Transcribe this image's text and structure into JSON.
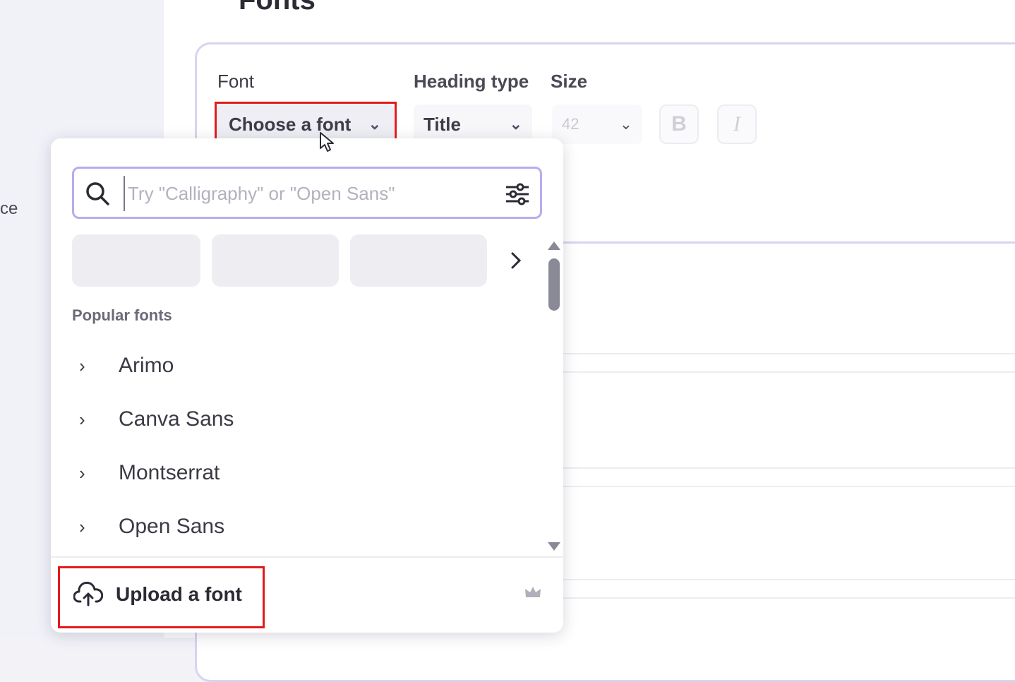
{
  "left_panel": {
    "partial_text": "ce"
  },
  "page": {
    "title": "Fonts"
  },
  "editor": {
    "font_label": "Font",
    "heading_type_label": "Heading type",
    "size_label": "Size",
    "font_select_value": "Choose a font",
    "heading_type_value": "Title",
    "size_value": "42",
    "bold_label": "B",
    "italic_label": "I"
  },
  "font_picker": {
    "search_placeholder": "Try \"Calligraphy\" or \"Open Sans\"",
    "popular_label": "Popular fonts",
    "popular_fonts": [
      "Arimo",
      "Canva Sans",
      "Montserrat",
      "Open Sans"
    ],
    "upload_label": "Upload a font"
  },
  "icons": [
    "search-icon",
    "filter-icon",
    "chevron-down-icon",
    "chevron-right-icon",
    "upload-cloud-icon",
    "crown-icon",
    "cursor-icon"
  ],
  "colors": {
    "highlight": "#e21b1b",
    "accent_border": "#b8acef"
  }
}
